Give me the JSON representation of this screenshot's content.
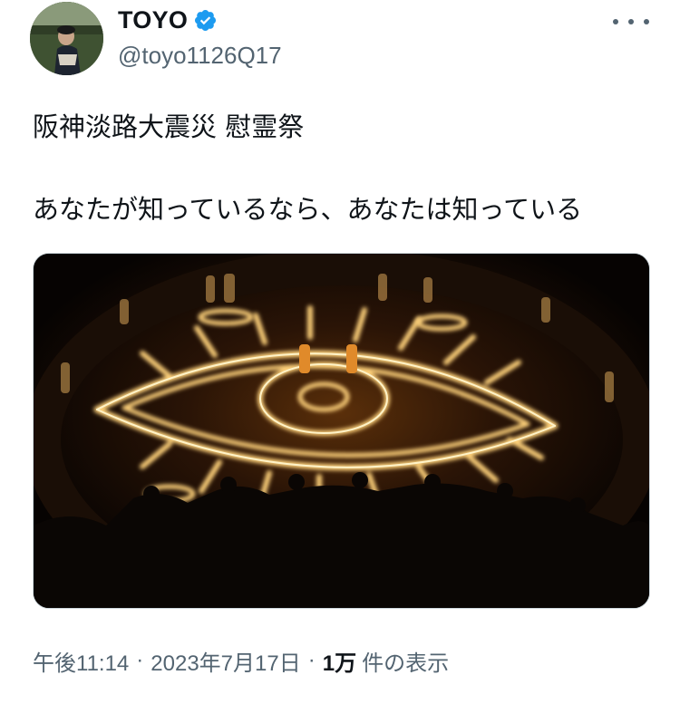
{
  "author": {
    "display_name": "TOYO",
    "handle": "@toyo1126Q17",
    "verified": true,
    "avatar_icon": "profile-photo",
    "verified_color": "#1d9bf0"
  },
  "tweet": {
    "text_lines": [
      "阪神淡路大震災 慰霊祭",
      "あなたが知っているなら、あなたは知っている"
    ],
    "media_icon": "photo-candle-eye-memorial"
  },
  "meta": {
    "time": "午後11:14",
    "separator": "·",
    "date": "2023年7月17日",
    "views_count": "1万",
    "views_label": "件の表示"
  },
  "colors": {
    "text": "#0f1419",
    "secondary": "#536471",
    "border": "#cfd9de",
    "flame": "#ffcf66"
  }
}
